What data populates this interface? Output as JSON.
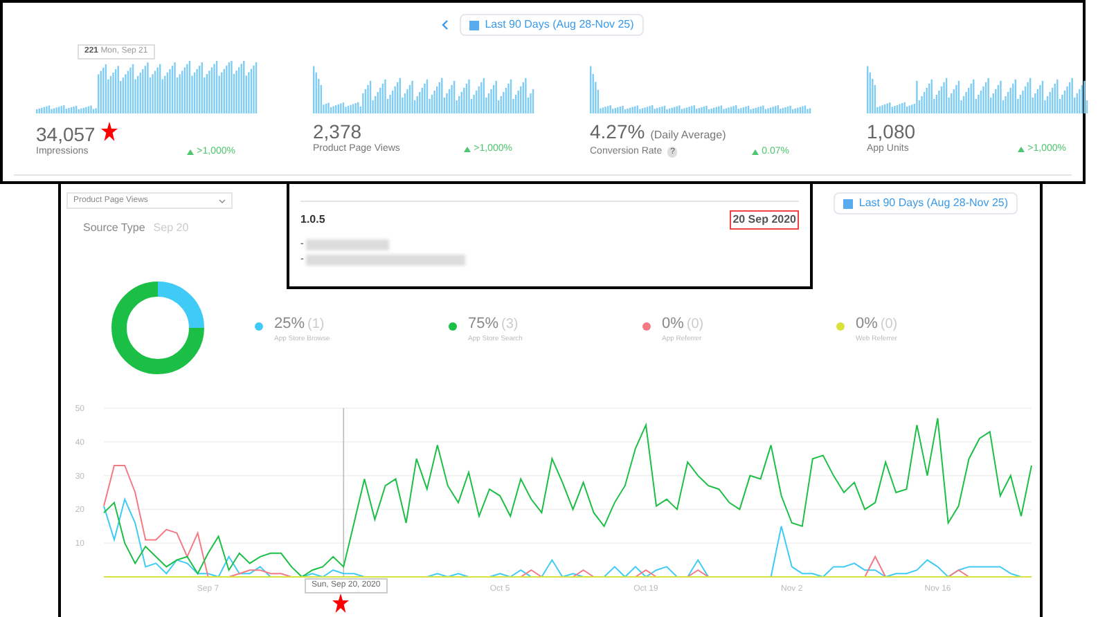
{
  "date_range": {
    "label": "Last 90 Days (Aug 28-Nov 25)"
  },
  "tooltip": {
    "value": "221",
    "date": "Mon, Sep 21"
  },
  "metrics": [
    {
      "value": "34,057",
      "label": "Impressions",
      "change": ">1,000%"
    },
    {
      "value": "2,378",
      "label": "Product Page Views",
      "change": ">1,000%"
    },
    {
      "value": "4.27%",
      "suffix": "(Daily Average)",
      "label": "Conversion Rate",
      "help": "?",
      "change": "0.07%"
    },
    {
      "value": "1,080",
      "label": "App Units",
      "change": ">1,000%"
    }
  ],
  "dropdown": {
    "value": "Product Page Views"
  },
  "source_type": {
    "title": "Source Type",
    "date": "Sep 20"
  },
  "date_range_2": {
    "label": "Last 90 Days (Aug 28-Nov 25)"
  },
  "release_popup": {
    "version": "1.0.5",
    "date": "20 Sep 2020",
    "notes": [
      {
        "marker": "-"
      },
      {
        "marker": "-"
      }
    ]
  },
  "sources": [
    {
      "percent": "25%",
      "count": "(1)",
      "label": "App Store Browse",
      "color": "#3fcbf5"
    },
    {
      "percent": "75%",
      "count": "(3)",
      "label": "App Store Search",
      "color": "#1cbf45"
    },
    {
      "percent": "0%",
      "count": "(0)",
      "label": "App Referrer",
      "color": "#f47a85"
    },
    {
      "percent": "0%",
      "count": "(0)",
      "label": "Web Referrer",
      "color": "#d7e23a"
    }
  ],
  "chart_tooltip": "Sun, Sep 20, 2020",
  "chart_data": {
    "type": "line",
    "categories": [
      null,
      null,
      null,
      null,
      null,
      null,
      null,
      null,
      null,
      null,
      "Sep 7",
      null,
      null,
      null,
      null,
      null,
      null,
      null,
      null,
      null,
      null,
      null,
      null,
      null,
      null,
      null,
      null,
      null,
      null,
      null,
      null,
      null,
      null,
      null,
      null,
      null,
      null,
      null,
      "Oct 5",
      null,
      null,
      null,
      null,
      null,
      null,
      null,
      null,
      null,
      null,
      null,
      null,
      null,
      "Oct 19",
      null,
      null,
      null,
      null,
      null,
      null,
      null,
      null,
      null,
      null,
      null,
      null,
      null,
      "Nov 2",
      null,
      null,
      null,
      null,
      null,
      null,
      null,
      null,
      null,
      null,
      null,
      null,
      null,
      "Nov 16",
      null,
      null,
      null,
      null,
      null,
      null,
      null,
      null,
      null
    ],
    "grid": true,
    "ylim": [
      0,
      50
    ],
    "yticks": [
      10,
      20,
      30,
      40,
      50
    ],
    "series": [
      {
        "color": "#3fcbf5",
        "values": [
          21,
          11,
          23,
          16,
          3,
          4,
          1,
          5,
          4,
          1,
          1,
          0,
          6,
          1,
          1,
          3,
          0,
          null,
          null,
          0,
          1,
          0,
          2,
          1,
          1,
          0,
          null,
          null,
          null,
          null,
          null,
          0,
          1,
          0,
          1,
          0,
          null,
          0,
          1,
          0,
          2,
          0,
          0,
          5,
          0,
          1,
          0,
          null,
          0,
          3,
          0,
          3,
          0,
          2,
          3,
          0,
          0,
          5,
          0,
          null,
          null,
          null,
          null,
          null,
          0,
          15,
          3,
          1,
          1,
          0,
          3,
          3,
          4,
          2,
          2,
          0,
          1,
          1,
          2,
          5,
          3,
          0,
          2,
          3,
          3,
          3,
          3,
          1,
          0,
          null
        ]
      },
      {
        "color": "#1cbf45",
        "values": [
          19,
          22,
          10,
          4,
          9,
          6,
          3,
          5,
          6,
          1,
          7,
          12,
          2,
          7,
          4,
          6,
          7,
          7,
          3,
          0,
          2,
          3,
          6,
          3,
          16,
          29,
          17,
          27,
          29,
          16,
          35,
          26,
          39,
          27,
          22,
          31,
          18,
          26,
          24,
          18,
          29,
          23,
          19,
          35,
          28,
          20,
          28,
          19,
          15,
          22,
          27,
          38,
          45,
          21,
          23,
          20,
          34,
          30,
          27,
          26,
          22,
          20,
          30,
          29,
          39,
          24,
          16,
          15,
          35,
          36,
          30,
          25,
          28,
          20,
          22,
          34,
          25,
          26,
          45,
          30,
          47,
          16,
          21,
          35,
          41,
          43,
          24,
          30,
          18,
          33
        ]
      },
      {
        "color": "#f47a85",
        "values": [
          21,
          33,
          33,
          25,
          11,
          11,
          14,
          13,
          6,
          13,
          0,
          null,
          0,
          1,
          2,
          2,
          1,
          1,
          0,
          null,
          null,
          null,
          null,
          null,
          null,
          null,
          null,
          null,
          null,
          null,
          null,
          null,
          null,
          null,
          null,
          null,
          null,
          null,
          null,
          null,
          0,
          2,
          0,
          null,
          null,
          0,
          2,
          0,
          null,
          null,
          null,
          0,
          2,
          0,
          null,
          null,
          0,
          2,
          0,
          null,
          null,
          null,
          null,
          null,
          null,
          null,
          null,
          null,
          null,
          null,
          null,
          null,
          null,
          0,
          6,
          0,
          null,
          null,
          null,
          null,
          null,
          0,
          2,
          0,
          null,
          null,
          null,
          null,
          null,
          null
        ]
      },
      {
        "color": "#d7e23a",
        "values": [
          0,
          0,
          0,
          0,
          0,
          0,
          0,
          0,
          0,
          0,
          0,
          0,
          0,
          0,
          0,
          0,
          0,
          0,
          0,
          0,
          0,
          0,
          0,
          0,
          0,
          0,
          0,
          0,
          0,
          0,
          0,
          0,
          0,
          0,
          0,
          0,
          0,
          0,
          0,
          0,
          0,
          0,
          0,
          0,
          0,
          0,
          0,
          0,
          0,
          0,
          0,
          0,
          0,
          0,
          0,
          0,
          0,
          0,
          0,
          0,
          0,
          0,
          0,
          0,
          0,
          0,
          0,
          0,
          0,
          0,
          0,
          0,
          0,
          0,
          0,
          0,
          0,
          0,
          0,
          0,
          0,
          0,
          0,
          0,
          0,
          0,
          0,
          0,
          0,
          0
        ]
      }
    ]
  }
}
